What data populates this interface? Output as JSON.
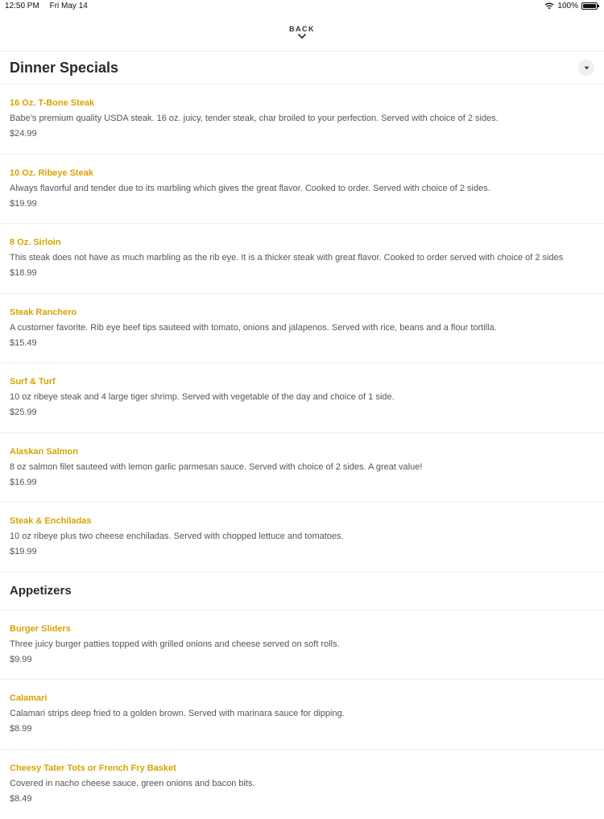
{
  "status": {
    "time": "12:50 PM",
    "date": "Fri May 14",
    "battery": "100%",
    "battery_level": 1.0
  },
  "nav": {
    "back_label": "BACK"
  },
  "sections": [
    {
      "title": "Dinner Specials",
      "items": [
        {
          "name": "16 Oz. T-Bone Steak",
          "description": "Babe’s premium quality USDA steak. 16 oz. juicy, tender steak, char broiled to your perfection. Served with choice of 2 sides.",
          "price": "$24.99"
        },
        {
          "name": "10 Oz. Ribeye Steak",
          "description": "Always flavorful and tender due to its marbling which gives the great flavor. Cooked to order. Served with choice of 2 sides.",
          "price": "$19.99"
        },
        {
          "name": "8 Oz. Sirloin",
          "description": "This steak does not have as much marbling as the rib eye. It is a thicker steak with great flavor. Cooked to order served with choice of 2 sides",
          "price": "$18.99"
        },
        {
          "name": "Steak Ranchero",
          "description": "A customer favorite. Rib eye beef tips sauteed with tomato, onions and jalapenos. Served with rice, beans and a flour tortilla.",
          "price": "$15.49"
        },
        {
          "name": "Surf & Turf",
          "description": "10 oz ribeye steak and 4 large tiger shrimp. Served with vegetable of the day and choice of 1 side.",
          "price": "$25.99"
        },
        {
          "name": "Alaskan Salmon",
          "description": "8 oz salmon filet sauteed with lemon garlic parmesan sauce. Served with choice of 2 sides. A great value!",
          "price": "$16.99"
        },
        {
          "name": "Steak & Enchiladas",
          "description": "10 oz ribeye plus two cheese enchiladas. Served with chopped lettuce and tomatoes.",
          "price": "$19.99"
        }
      ]
    },
    {
      "title": "Appetizers",
      "items": [
        {
          "name": "Burger Sliders",
          "description": "Three juicy burger patties topped with grilled onions and cheese served on soft rolls.",
          "price": "$9.99"
        },
        {
          "name": "Calamari",
          "description": "Calamari strips deep fried to a golden brown. Served with marinara sauce for dipping.",
          "price": "$8.99"
        },
        {
          "name": "Cheesy Tater Tots or French Fry Basket",
          "description": "Covered in nacho cheese sauce, green onions and bacon bits.",
          "price": "$8.49"
        }
      ]
    }
  ],
  "colors": {
    "item_name": "#d7a300",
    "text": "#555555",
    "divider": "#eeeeee"
  }
}
